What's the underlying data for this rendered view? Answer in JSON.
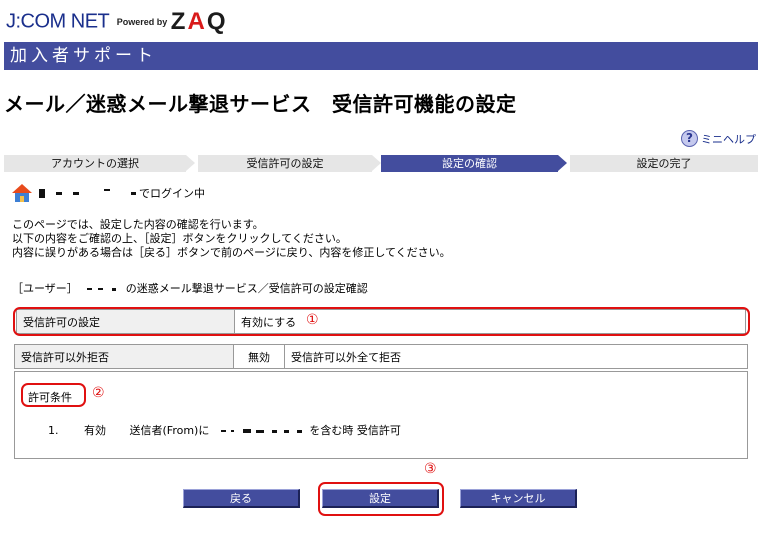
{
  "logo": {
    "brand": "J:COM NET",
    "powered": "Powered by",
    "zaq_z": "Z",
    "zaq_a": "A",
    "zaq_q": "Q"
  },
  "banner": {
    "title": "加入者サポート"
  },
  "page_title": "メール／迷惑メール撃退サービス　受信許可機能の設定",
  "help": {
    "label": "ミニヘルプ",
    "icon": "question-icon"
  },
  "steps": [
    {
      "label": "アカウントの選択",
      "active": false
    },
    {
      "label": "受信許可の設定",
      "active": false
    },
    {
      "label": "設定の確認",
      "active": true
    },
    {
      "label": "設定の完了",
      "active": false
    }
  ],
  "login": {
    "suffix": "でログイン中",
    "icon": "home-icon"
  },
  "intro": {
    "line1": "このページでは、設定した内容の確認を行います。",
    "line2": "以下の内容をご確認の上、［設定］ボタンをクリックしてください。",
    "line3": "内容に誤りがある場合は［戻る］ボタンで前のページに戻り、内容を修正してください。"
  },
  "user_line": {
    "prefix": "［ユーザー］",
    "suffix": "の迷惑メール撃退サービス／受信許可の設定確認"
  },
  "setting_row": {
    "label": "受信許可の設定",
    "value": "有効にする"
  },
  "reject_row": {
    "label": "受信許可以外拒否",
    "status": "無効",
    "desc": "受信許可以外全て拒否"
  },
  "conditions": {
    "title": "許可条件",
    "item": {
      "no": "1.",
      "state": "有効",
      "prefix": "送信者(From)に",
      "suffix": "を含む時 受信許可"
    }
  },
  "annotations": {
    "n1": "①",
    "n2": "②",
    "n3": "③"
  },
  "buttons": {
    "back": "戻る",
    "set": "設定",
    "cancel": "キャンセル"
  },
  "colors": {
    "brand": "#434d9e",
    "annotation": "#e01010",
    "step_inactive": "#e6e6e6"
  }
}
